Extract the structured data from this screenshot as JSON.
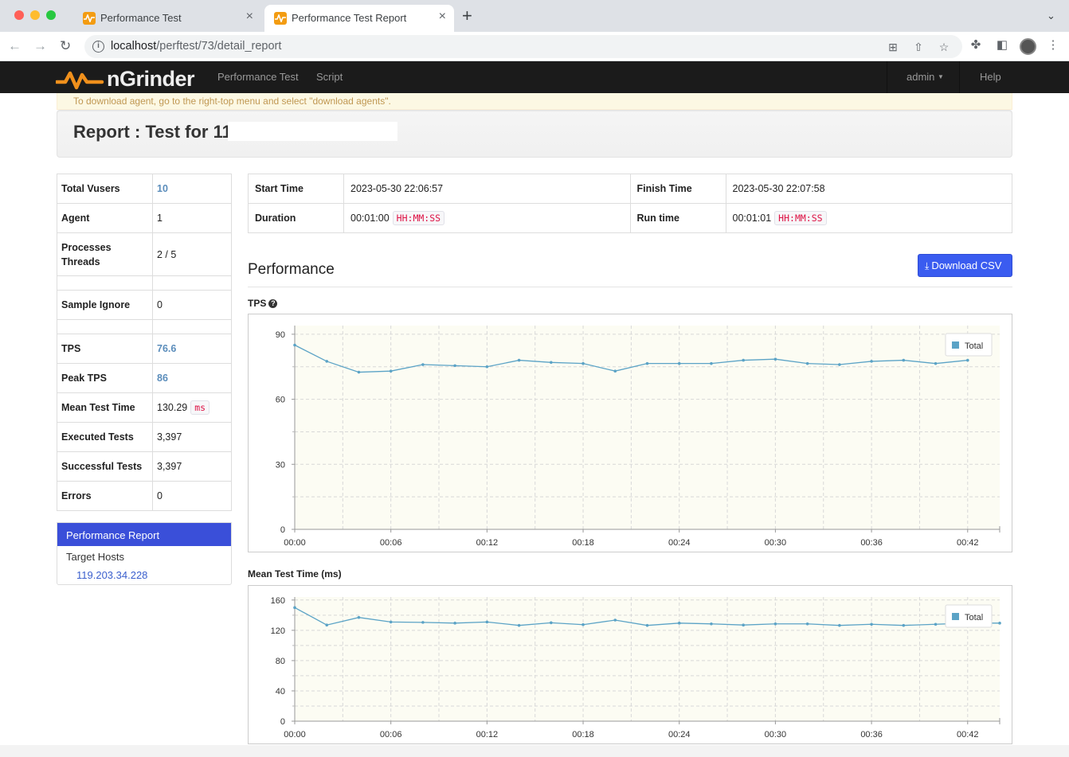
{
  "browser": {
    "tabs": [
      {
        "title": "Performance Test"
      },
      {
        "title": "Performance Test Report"
      }
    ],
    "url_host": "localhost",
    "url_path": "/perftest/73/detail_report"
  },
  "nav": {
    "brand": "nGrinder",
    "links": [
      "Performance Test",
      "Script"
    ],
    "user": "admin",
    "help": "Help"
  },
  "alert": "To download agent, go to the right-top menu and select \"download agents\".",
  "report_title": "Report : Test for 119",
  "summary": [
    {
      "label": "Total Vusers",
      "value": "10",
      "highlight": true
    },
    {
      "label": "Agent",
      "value": "1"
    },
    {
      "label": "Processes Threads",
      "value": "2 / 5"
    },
    {
      "label": "Sample Ignore",
      "value": "0"
    },
    {
      "label": "TPS",
      "value": "76.6",
      "highlight": true
    },
    {
      "label": "Peak TPS",
      "value": "86",
      "highlight": true
    },
    {
      "label": "Mean Test Time",
      "value": "130.29",
      "unit": "ms"
    },
    {
      "label": "Executed Tests",
      "value": "3,397"
    },
    {
      "label": "Successful Tests",
      "value": "3,397"
    },
    {
      "label": "Errors",
      "value": "0"
    }
  ],
  "sidenav": {
    "active": "Performance Report",
    "header": "Target Hosts",
    "host": "119.203.34.228"
  },
  "times": {
    "start_label": "Start Time",
    "start_value": "2023-05-30 22:06:57",
    "finish_label": "Finish Time",
    "finish_value": "2023-05-30 22:07:58",
    "duration_label": "Duration",
    "duration_value": "00:01:00",
    "runtime_label": "Run time",
    "runtime_value": "00:01:01",
    "format": "HH:MM:SS"
  },
  "performance": {
    "heading": "Performance",
    "download": "Download CSV"
  },
  "chart_data": [
    {
      "type": "line",
      "title": "TPS",
      "legend": "top-right",
      "grid": true,
      "x_ticks": [
        "00:00",
        "00:06",
        "00:12",
        "00:18",
        "00:24",
        "00:30",
        "00:36",
        "00:42"
      ],
      "x": [
        0,
        2,
        4,
        6,
        8,
        10,
        12,
        14,
        16,
        18,
        20,
        22,
        24,
        26,
        28,
        30,
        32,
        34,
        36,
        38,
        40,
        42,
        44
      ],
      "ylim": [
        0,
        94
      ],
      "y_ticks": [
        0,
        30,
        60,
        90
      ],
      "series": [
        {
          "name": "Total",
          "values": [
            85,
            77.5,
            72.5,
            73,
            76,
            75.5,
            75,
            78,
            77,
            76.5,
            73,
            76.5,
            76.5,
            76.5,
            78,
            78.5,
            76.5,
            76,
            77.5,
            78,
            76.5,
            78
          ]
        }
      ]
    },
    {
      "type": "line",
      "title": "Mean Test Time (ms)",
      "legend": "top-right",
      "grid": true,
      "x_ticks": [
        "00:00",
        "00:06",
        "00:12",
        "00:18",
        "00:24",
        "00:30",
        "00:36",
        "00:42"
      ],
      "x": [
        0,
        2,
        4,
        6,
        8,
        10,
        12,
        14,
        16,
        18,
        20,
        22,
        24,
        26,
        28,
        30,
        32,
        34,
        36,
        38,
        40,
        42,
        44
      ],
      "ylim": [
        0,
        164
      ],
      "y_ticks": [
        0,
        40,
        80,
        120,
        160
      ],
      "series": [
        {
          "name": "Total",
          "values": [
            150,
            127,
            137,
            131,
            130.5,
            129.5,
            131,
            126.5,
            130,
            127.5,
            133.5,
            126.5,
            129.5,
            128.5,
            127,
            128.5,
            128.5,
            126.5,
            128,
            126.5,
            128,
            129.5,
            129.5
          ]
        }
      ]
    }
  ]
}
